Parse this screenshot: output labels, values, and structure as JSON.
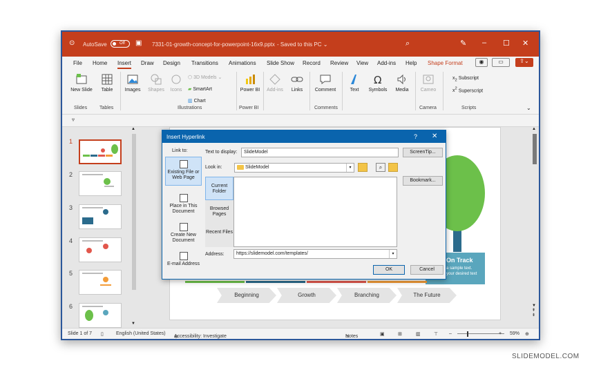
{
  "titlebar": {
    "autosave_label": "AutoSave",
    "autosave_state": "Off",
    "document_title": "7331-01-growth-concept-for-powerpoint-16x9.pptx",
    "save_status": "Saved to this PC"
  },
  "menu": [
    "File",
    "Home",
    "Insert",
    "Draw",
    "Design",
    "Transitions",
    "Animations",
    "Slide Show",
    "Record",
    "Review",
    "View",
    "Add-ins",
    "Help",
    "Shape Format"
  ],
  "ribbon": {
    "new_slide": "New Slide",
    "table": "Table",
    "images": "Images",
    "shapes": "Shapes",
    "icons": "Icons",
    "models_3d": "3D Models",
    "smartart": "SmartArt",
    "chart": "Chart",
    "power_bi": "Power BI",
    "addins": "Add-ins",
    "links": "Links",
    "comment": "Comment",
    "text": "Text",
    "symbols": "Symbols",
    "media": "Media",
    "cameo": "Cameo",
    "subscript": "Subscript",
    "superscript": "Superscript",
    "groups": {
      "slides": "Slides",
      "tables": "Tables",
      "illustrations": "Illustrations",
      "power_bi": "Power BI",
      "comments": "Comments",
      "camera": "Camera",
      "scripts": "Scripts"
    }
  },
  "thumbnails": [
    "1",
    "2",
    "3",
    "4",
    "5",
    "6"
  ],
  "slide": {
    "steps": [
      "Beginning",
      "Growth",
      "Branching",
      "The Future"
    ],
    "box_title": "On Track",
    "box_line1": "a sample text.",
    "box_line2": "your desired text"
  },
  "dialog": {
    "title": "Insert Hyperlink",
    "help": "?",
    "link_to_label": "Link to:",
    "link_to": [
      "Existing File or Web Page",
      "Place in This Document",
      "Create New Document",
      "E-mail Address"
    ],
    "text_to_display_label": "Text to display:",
    "text_to_display_value": "SlideModel",
    "screentip_button": "ScreenTip...",
    "look_in_label": "Look in:",
    "look_in_value": "SlideModel",
    "bookmark_button": "Bookmark...",
    "sub_nav": [
      "Current Folder",
      "Browsed Pages",
      "Recent Files"
    ],
    "address_label": "Address:",
    "address_value": "https://slidemodel.com/templates/",
    "ok_button": "OK",
    "cancel_button": "Cancel"
  },
  "status": {
    "slide_info": "Slide 1 of 7",
    "language": "English (United States)",
    "accessibility": "Accessibility: Investigate",
    "notes": "Notes",
    "zoom": "59%"
  },
  "watermark": "SLIDEMODEL.COM",
  "colors": {
    "title_bar": "#c43e1c",
    "dialog_accent": "#0a64ad",
    "slide_box": "#5aa6bd",
    "tree_green": "#6cc04a",
    "selected_border": "#c43e1c"
  }
}
